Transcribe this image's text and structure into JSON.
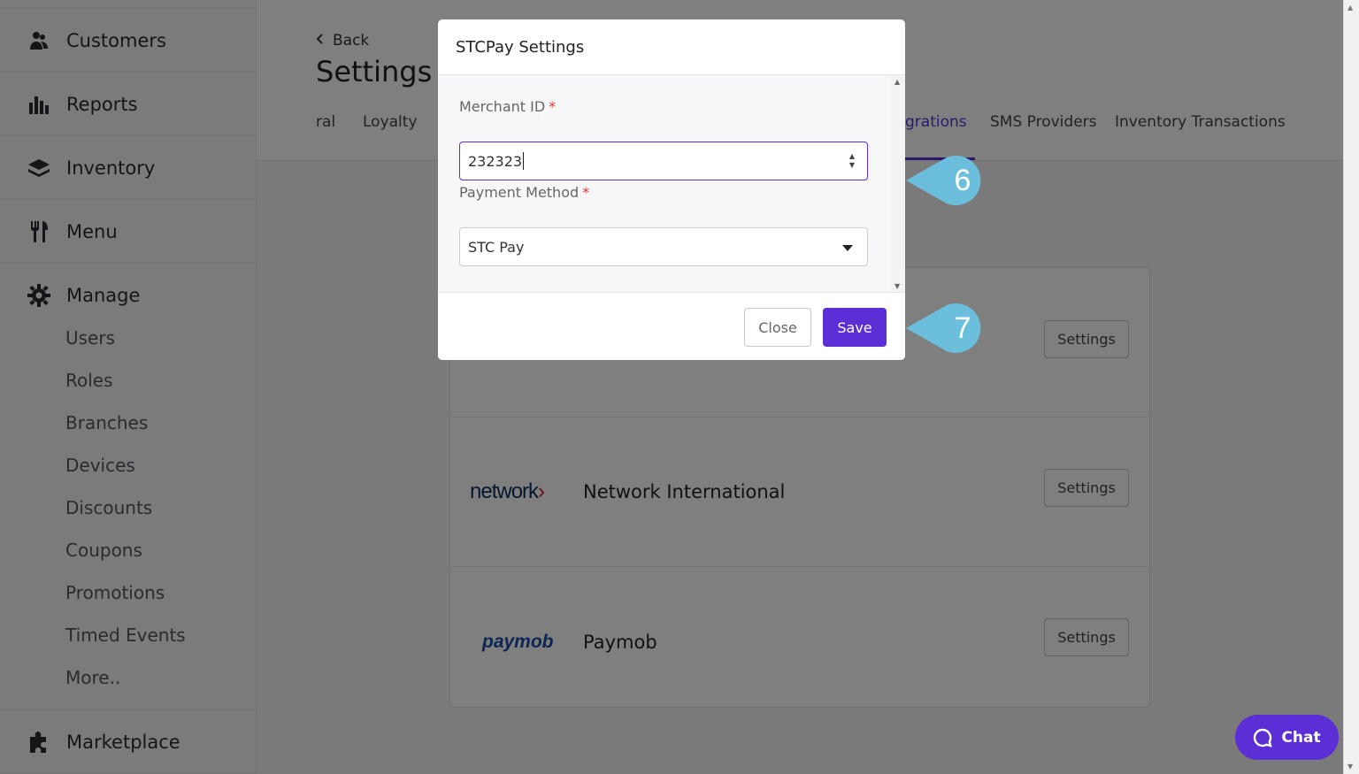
{
  "sidebar": {
    "items": [
      {
        "label": "Customers",
        "icon": "customers-icon"
      },
      {
        "label": "Reports",
        "icon": "bar-chart-icon"
      },
      {
        "label": "Inventory",
        "icon": "layers-icon"
      },
      {
        "label": "Menu",
        "icon": "fork-knife-icon"
      },
      {
        "label": "Manage",
        "icon": "gear-icon"
      }
    ],
    "manage_sub": [
      "Users",
      "Roles",
      "Branches",
      "Devices",
      "Discounts",
      "Coupons",
      "Promotions",
      "Timed Events",
      "More.."
    ],
    "marketplace": {
      "label": "Marketplace",
      "icon": "puzzle-icon"
    }
  },
  "header": {
    "back_label": "Back",
    "title": "Settings",
    "tabs": [
      "ral",
      "Loyalty",
      "grations",
      "SMS Providers",
      "Inventory Transactions"
    ],
    "active_tab_index": 2
  },
  "integrations": [
    {
      "name": "",
      "settings_label": "Settings"
    },
    {
      "logo_text": "network",
      "logo_arrow": "›",
      "name": "Network International",
      "settings_label": "Settings"
    },
    {
      "logo_text": "paymob",
      "name": "Paymob",
      "settings_label": "Settings"
    }
  ],
  "modal": {
    "title": "STCPay Settings",
    "ghost_number": "4",
    "merchant_label": "Merchant ID",
    "merchant_value": "232323",
    "payment_label": "Payment Method",
    "payment_value": "STC Pay",
    "required_mark": "*",
    "close_label": "Close",
    "save_label": "Save"
  },
  "callouts": [
    "6",
    "7"
  ],
  "chat": {
    "label": "Chat"
  },
  "colors": {
    "accent": "#5b2ed6",
    "callout": "#6bbfdc"
  }
}
